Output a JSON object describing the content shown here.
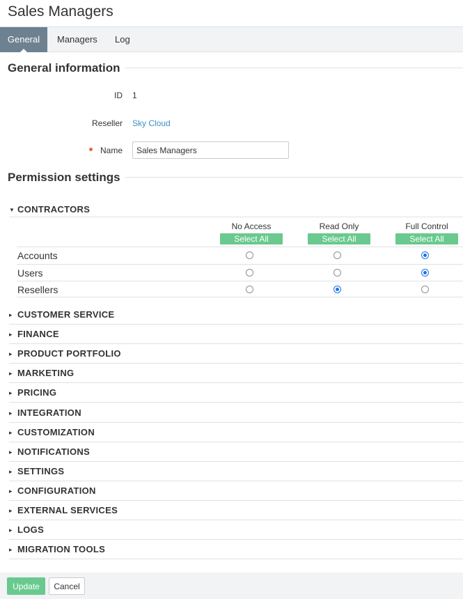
{
  "page": {
    "title": "Sales Managers"
  },
  "tabs": [
    {
      "label": "General",
      "active": true
    },
    {
      "label": "Managers",
      "active": false
    },
    {
      "label": "Log",
      "active": false
    }
  ],
  "general": {
    "section_title": "General information",
    "id_label": "ID",
    "id_value": "1",
    "reseller_label": "Reseller",
    "reseller_value": "Sky Cloud",
    "name_label": "Name",
    "name_value": "Sales Managers",
    "name_required": true
  },
  "permissions": {
    "section_title": "Permission settings",
    "columns": [
      {
        "label": "No Access",
        "select_all": "Select All"
      },
      {
        "label": "Read Only",
        "select_all": "Select All"
      },
      {
        "label": "Full Control",
        "select_all": "Select All"
      }
    ],
    "expanded_group": {
      "label": "CONTRACTORS",
      "rows": [
        {
          "name": "Accounts",
          "selected": "Full Control"
        },
        {
          "name": "Users",
          "selected": "Full Control"
        },
        {
          "name": "Resellers",
          "selected": "Read Only"
        }
      ]
    },
    "collapsed_groups": [
      "CUSTOMER SERVICE",
      "FINANCE",
      "PRODUCT PORTFOLIO",
      "MARKETING",
      "PRICING",
      "INTEGRATION",
      "CUSTOMIZATION",
      "NOTIFICATIONS",
      "SETTINGS",
      "CONFIGURATION",
      "EXTERNAL SERVICES",
      "LOGS",
      "MIGRATION TOOLS"
    ]
  },
  "footer": {
    "update_label": "Update",
    "cancel_label": "Cancel"
  },
  "colors": {
    "accent_green": "#69c98e",
    "tab_active": "#6e8190",
    "link": "#3f8fc6",
    "radio_checked": "#1a73e8",
    "required_dot": "#e8673a"
  }
}
